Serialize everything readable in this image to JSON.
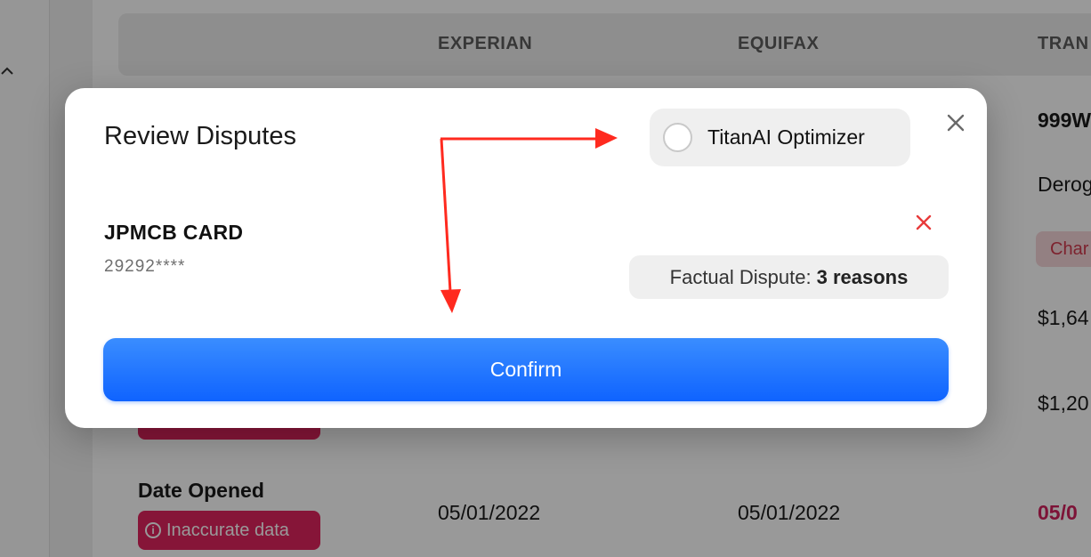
{
  "background": {
    "columns": [
      "EXPERIAN",
      "EQUIFAX",
      "TRAN"
    ],
    "right_column": {
      "header_value": "999W",
      "derog": "Derog",
      "chip": "Char",
      "amount_1": "$1,64",
      "amount_2": "$1,20",
      "date": "05/0"
    },
    "date_opened": {
      "label": "Date Opened",
      "badge": "Inaccurate data",
      "experian": "05/01/2022",
      "equifax": "05/01/2022"
    }
  },
  "modal": {
    "title": "Review Disputes",
    "optimizer_label": "TitanAI Optimizer",
    "optimizer_checked": false,
    "account": {
      "name": "JPMCB CARD",
      "number": "29292****"
    },
    "dispute": {
      "prefix": "Factual Dispute:",
      "count": "3 reasons"
    },
    "confirm_label": "Confirm"
  },
  "colors": {
    "accent": "#0f63ff",
    "badge": "#e0245e",
    "annotation_arrow": "#ff2a1f",
    "remove": "#e83a3a"
  },
  "icons": [
    "chevron-up-icon",
    "close-icon",
    "remove-x-icon",
    "info-icon"
  ]
}
